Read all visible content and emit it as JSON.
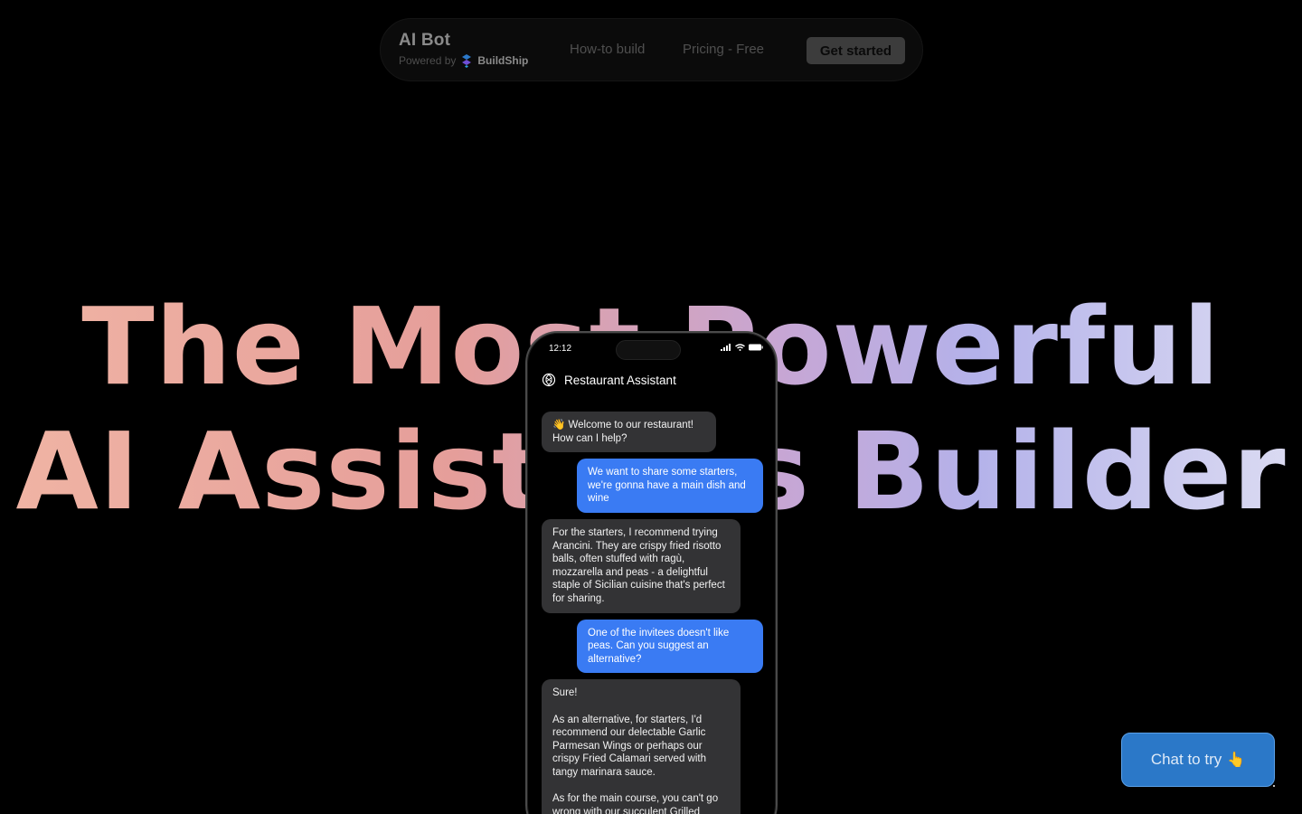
{
  "nav": {
    "brand_title": "AI Bot",
    "powered_by": "Powered by",
    "powered_brand": "BuildShip",
    "links": [
      {
        "label": "How-to build"
      },
      {
        "label": "Pricing - Free"
      }
    ],
    "cta_label": "Get started"
  },
  "hero": {
    "line1": "The Most Powerful",
    "line2": "AI Assistants Builder",
    "gradient_colors": [
      "#f0b4a4",
      "#e59e9a",
      "#c7a6d4",
      "#b4b2ea",
      "#dcdcf2"
    ]
  },
  "phone": {
    "time": "12:12",
    "chat_title": "Restaurant Assistant",
    "messages": [
      {
        "role": "bot",
        "text": "👋 Welcome to our restaurant!\nHow can I help?"
      },
      {
        "role": "user",
        "text": "We want to share some starters, we're gonna have a main dish and wine"
      },
      {
        "role": "bot",
        "text": "For the starters, I recommend trying Arancini. They are crispy fried risotto balls, often stuffed with ragù, mozzarella and peas - a delightful staple of Sicilian cuisine that's perfect for sharing."
      },
      {
        "role": "user",
        "text": "One of the invitees doesn't like peas. Can you suggest an alternative?"
      },
      {
        "role": "bot",
        "text": "Sure!\n\nAs an alternative, for starters, I'd recommend our delectable Garlic Parmesan Wings or perhaps our crispy Fried Calamari served with tangy marinara sauce.\n\nAs for the main course, you can't go wrong with our succulent Grilled"
      }
    ]
  },
  "chat_button": {
    "label": "Chat to try",
    "icon": "pointing-hand-icon"
  },
  "colors": {
    "background": "#000000",
    "user_bubble": "#3a7bf3",
    "bot_bubble": "#333335",
    "chat_button": "#2b78c8"
  }
}
